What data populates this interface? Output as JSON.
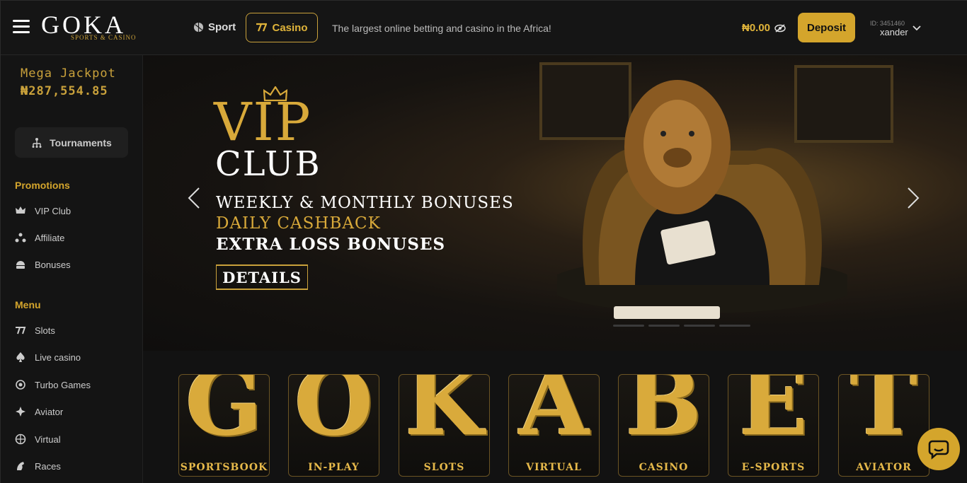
{
  "header": {
    "logo_main": "GOKA",
    "logo_sub": "SPORTS & CASINO",
    "nav_sport": "Sport",
    "nav_casino": "Casino",
    "tagline": "The largest online betting and casino in the Africa!",
    "balance": "₦0.00",
    "deposit_label": "Deposit",
    "user_id": "ID: 3451460",
    "username": "xander"
  },
  "sidebar": {
    "jackpot_title": "Mega Jackpot",
    "jackpot_value": "₦287,554.85",
    "tournaments_label": "Tournaments",
    "promotions_title": "Promotions",
    "promotions": [
      {
        "label": "VIP Club",
        "icon": "crown-icon"
      },
      {
        "label": "Affiliate",
        "icon": "affiliate-icon"
      },
      {
        "label": "Bonuses",
        "icon": "bonus-icon"
      }
    ],
    "menu_title": "Menu",
    "menu": [
      {
        "label": "Slots",
        "icon": "slots-icon"
      },
      {
        "label": "Live casino",
        "icon": "spade-icon"
      },
      {
        "label": "Turbo Games",
        "icon": "turbo-icon"
      },
      {
        "label": "Aviator",
        "icon": "aviator-icon"
      },
      {
        "label": "Virtual",
        "icon": "virtual-icon"
      },
      {
        "label": "Races",
        "icon": "races-icon"
      }
    ]
  },
  "banner": {
    "vip": "VIP",
    "club": "CLUB",
    "line1": "WEEKLY & MONTHLY BONUSES",
    "line2": "DAILY CASHBACK",
    "line3": "EXTRA LOSS BONUSES",
    "details_label": "DETAILS"
  },
  "categories": [
    {
      "letter": "G",
      "label": "SPORTSBOOK"
    },
    {
      "letter": "O",
      "label": "IN-PLAY"
    },
    {
      "letter": "K",
      "label": "SLOTS"
    },
    {
      "letter": "A",
      "label": "VIRTUAL"
    },
    {
      "letter": "B",
      "label": "CASINO"
    },
    {
      "letter": "E",
      "label": "E-SPORTS"
    },
    {
      "letter": "T",
      "label": "AVIATOR"
    }
  ],
  "colors": {
    "accent": "#d4a52c",
    "background": "#141414"
  }
}
